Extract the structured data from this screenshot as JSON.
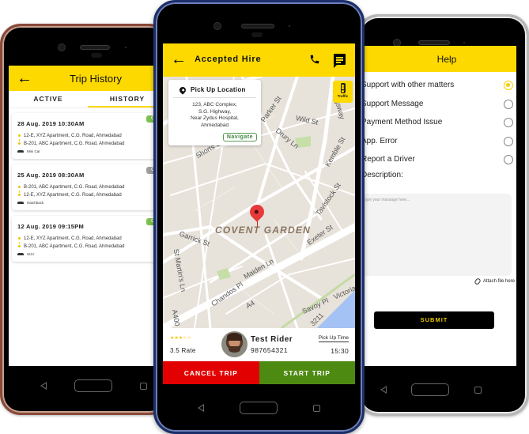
{
  "trip_history": {
    "title": "Trip History",
    "back_icon": "arrow-left-icon",
    "tabs": [
      {
        "label": "ACTIVE",
        "active": false
      },
      {
        "label": "HISTORY",
        "active": true
      }
    ],
    "trips": [
      {
        "datetime": "28 Aug. 2019  10:30AM",
        "status": "COMPL",
        "status_color": "#7cc24a",
        "from": "12-E, XYZ Apartment, C.G. Road, Ahmedabad",
        "to": "B-201, ABC Apartment, C.G. Road, Ahmedabad",
        "car_type": "Mini Car",
        "payment": ""
      },
      {
        "datetime": "25 Aug. 2019  08:30AM",
        "status": "CANCE",
        "status_color": "#9e9e9e",
        "from": "B-201, ABC Apartment, C.G. Road, Ahmedabad",
        "to": "12-E, XYZ Apartment, C.G. Road, Ahmedabad",
        "car_type": "Hatchback",
        "payment": ""
      },
      {
        "datetime": "12 Aug. 2019  09:15PM",
        "status": "COMPL",
        "status_color": "#7cc24a",
        "from": "12-E, XYZ Apartment, C.G. Road, Ahmedabad",
        "to": "B-201, ABC Apartment, C.G. Road, Ahmedabad",
        "car_type": "SUV",
        "payment": "C"
      }
    ]
  },
  "accepted_hire": {
    "title": "Accepted Hire",
    "icons": {
      "back": "arrow-left-icon",
      "call": "phone-icon",
      "message": "chat-icon",
      "traffic": "traffic-light-icon",
      "pin": "location-pin-icon"
    },
    "pickup": {
      "title": "Pick Up Location",
      "address_lines": [
        "123, ABC Complex,",
        "S.G. Highway,",
        "Near Zydus Hospital,",
        "Ahmedabad"
      ],
      "navigate_label": "Navigate"
    },
    "traffic_label": "Traffic",
    "map": {
      "area_label": "COVENT GARDEN",
      "street_labels": [
        "Parker St",
        "Wild St",
        "Drury Ln",
        "Kingsway",
        "Kemble St",
        "Shorts Gardens",
        "Garrick St",
        "St Martin's Ln",
        "Tavistock St",
        "Exeter St",
        "Maiden Ln",
        "Chandos Pl",
        "A4",
        "Savoy Pl",
        "A400",
        "Victoria",
        "3211"
      ]
    },
    "rider": {
      "rating_stars": 3.5,
      "rating_max": 5,
      "rating_text": "3.5 Rate",
      "name": "Test Rider",
      "phone": "987654321",
      "pickup_time_label": "Pick Up Time",
      "pickup_time": "15:30"
    },
    "cancel_label": "CANCEL TRIP",
    "start_label": "START TRIP",
    "colors": {
      "accent": "#fdd900",
      "cancel": "#e30000",
      "start": "#4d8a12"
    }
  },
  "help": {
    "title": "Help",
    "options": [
      {
        "label": "Support with other matters",
        "selected": true
      },
      {
        "label": "Support Message",
        "selected": false
      },
      {
        "label": "Payment Method Issue",
        "selected": false
      },
      {
        "label": "App. Error",
        "selected": false
      },
      {
        "label": "Report a Driver",
        "selected": false
      }
    ],
    "description_label": "Description:",
    "description_placeholder": "Type your massage here...",
    "attach_label": "Attach file here",
    "submit_label": "SUBMIT"
  }
}
